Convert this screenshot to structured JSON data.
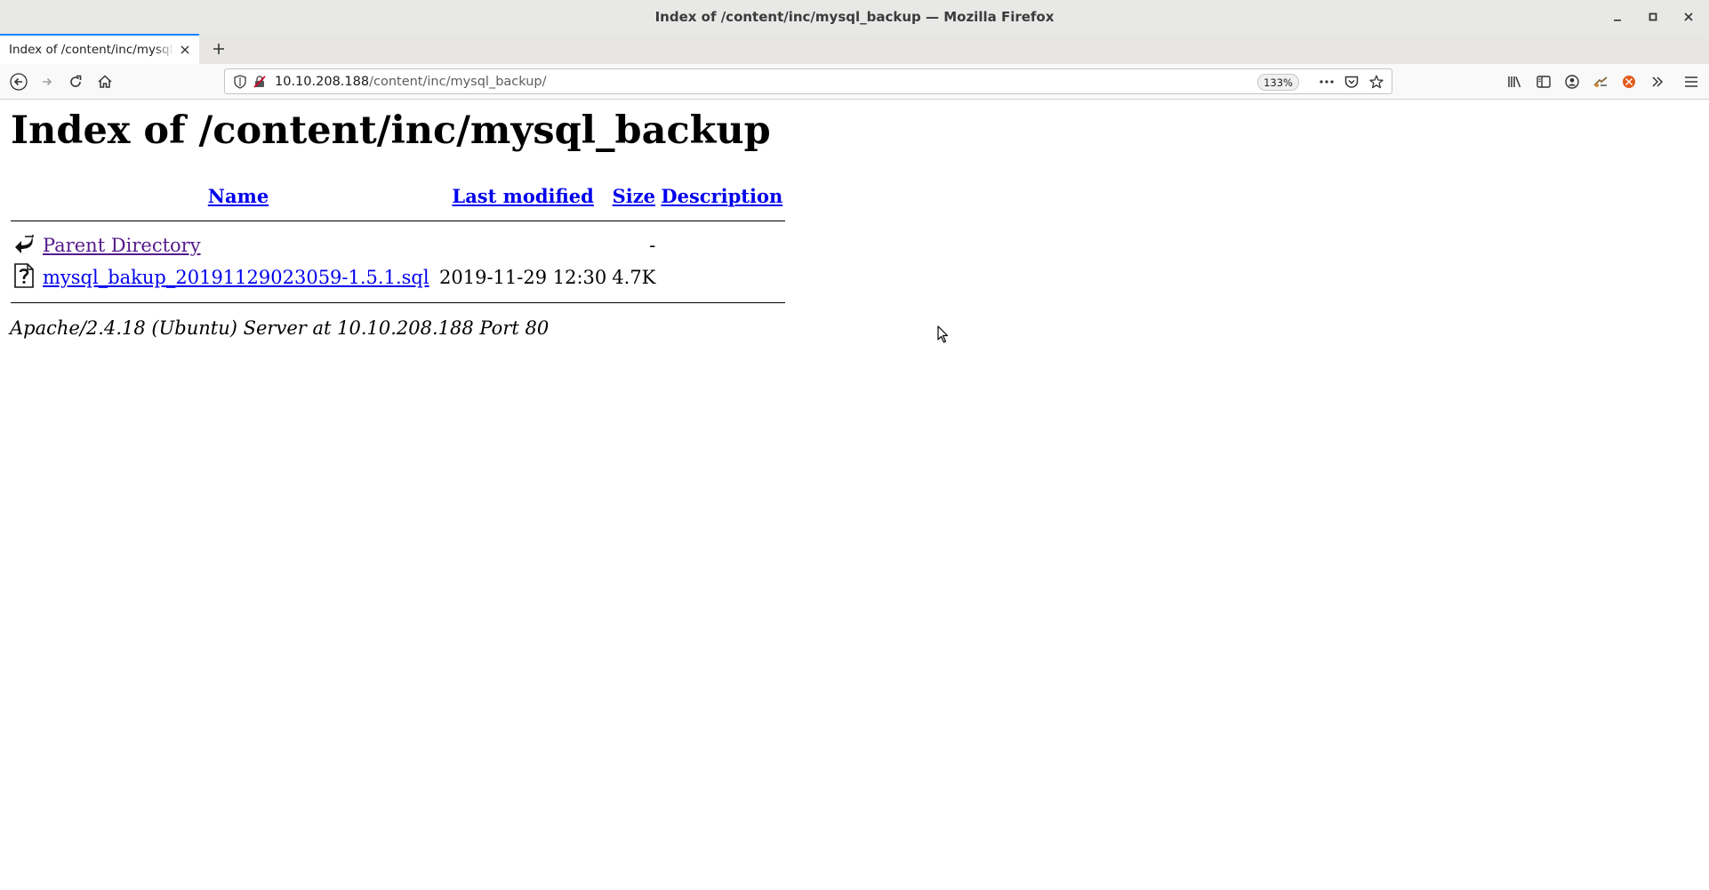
{
  "window": {
    "title": "Index of /content/inc/mysql_backup — Mozilla Firefox",
    "controls": [
      "minimize",
      "maximize",
      "close"
    ]
  },
  "tab": {
    "label": "Index of /content/inc/mysql_backup",
    "close_icon": "close-icon"
  },
  "toolbar": {
    "url_host": "10.10.208.188",
    "url_path": "/content/inc/mysql_backup/",
    "zoom": "133%"
  },
  "page": {
    "heading": "Index of /content/inc/mysql_backup",
    "columns": {
      "name": "Name",
      "last_modified": "Last modified",
      "size": "Size",
      "description": "Description"
    },
    "rows": [
      {
        "icon": "parent-directory-icon",
        "name": "Parent Directory",
        "last_modified": "",
        "size": "-",
        "description": ""
      },
      {
        "icon": "unknown-file-icon",
        "name": "mysql_bakup_20191129023059-1.5.1.sql",
        "last_modified": "2019-11-29 12:30",
        "size": "4.7K",
        "description": ""
      }
    ],
    "address": "Apache/2.4.18 (Ubuntu) Server at 10.10.208.188 Port 80"
  },
  "colors": {
    "accent": "#0a84ff",
    "link": "#0000ee",
    "visited_link": "#551a8b"
  }
}
